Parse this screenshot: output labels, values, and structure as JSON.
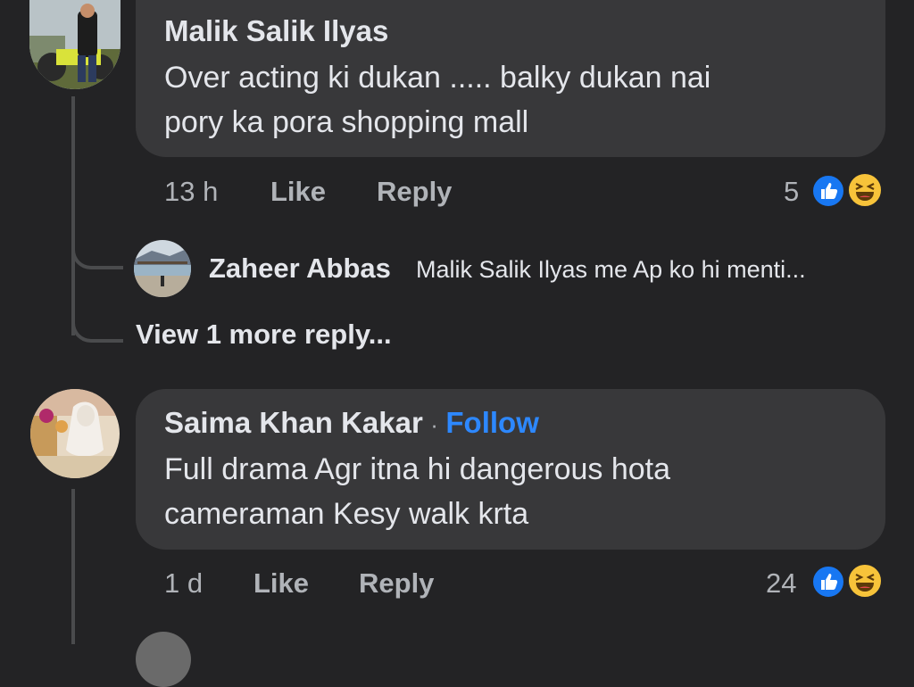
{
  "comments": [
    {
      "author": "Malik Salik Ilyas",
      "text_line1": "Over acting ki dukan ..... balky dukan nai",
      "text_line2": "pory ka pora shopping mall",
      "time": "13 h",
      "like_label": "Like",
      "reply_label": "Reply",
      "reaction_count": "5"
    },
    {
      "author": "Saima Khan Kakar",
      "separator": "·",
      "follow_label": "Follow",
      "text_line1": "Full drama Agr itna hi dangerous hota",
      "text_line2": "cameraman Kesy walk krta",
      "time": "1 d",
      "like_label": "Like",
      "reply_label": "Reply",
      "reaction_count": "24"
    }
  ],
  "reply": {
    "author": "Zaheer Abbas",
    "mention": "Malik Salik Ilyas",
    "text": " me Ap ko hi menti..."
  },
  "view_more": "View 1 more reply...",
  "colors": {
    "background": "#232325",
    "bubble": "#38383a",
    "follow": "#2d88ff",
    "like": "#1877f2",
    "haha": "#f7c33a"
  }
}
